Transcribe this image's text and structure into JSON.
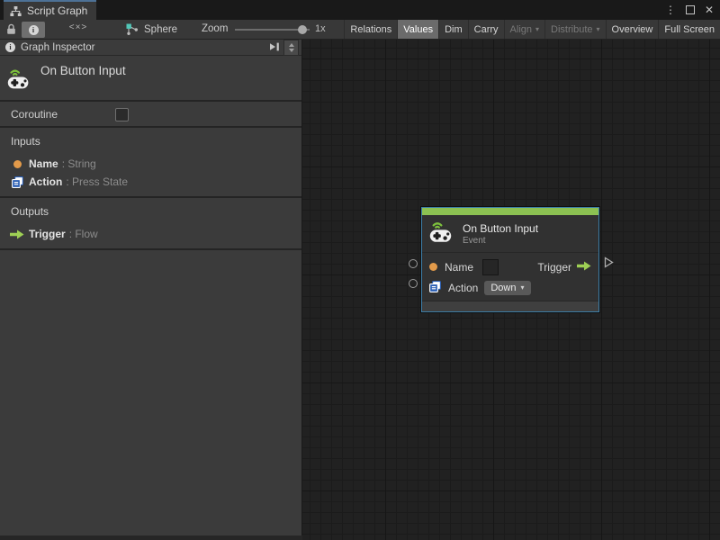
{
  "colors": {
    "accent_green": "#8cc152",
    "selection_blue": "#3d7ea8",
    "string_orange": "#e29a4a",
    "flow_green": "#9ed054",
    "enum_blue": "#2b5fb4",
    "focus_tab_blue": "#4d7196",
    "graph_icon_teal": "#52c7b8"
  },
  "icons": {
    "chevron_down": "▾",
    "kebab_menu": "⋮",
    "close": "✕",
    "code_view": "<×>"
  },
  "tabbar": {
    "tab_label": "Script Graph"
  },
  "toolbar": {
    "graph_name": "Sphere",
    "zoom_label": "Zoom",
    "zoom_value": "1x",
    "buttons": [
      {
        "label": "Relations",
        "state": "normal"
      },
      {
        "label": "Values",
        "state": "selected"
      },
      {
        "label": "Dim",
        "state": "normal"
      },
      {
        "label": "Carry",
        "state": "normal"
      },
      {
        "label": "Align",
        "state": "disabled",
        "dropdown": true
      },
      {
        "label": "Distribute",
        "state": "disabled",
        "dropdown": true
      },
      {
        "label": "Overview",
        "state": "normal"
      },
      {
        "label": "Full Screen",
        "state": "normal"
      }
    ]
  },
  "inspector": {
    "header_title": "Graph Inspector",
    "unit_title": "On Button Input",
    "coroutine": {
      "label": "Coroutine",
      "checked": false
    },
    "inputs": {
      "title": "Inputs",
      "items": [
        {
          "name": "Name",
          "type_text": ": String"
        },
        {
          "name": "Action",
          "type_text": ": Press State"
        }
      ]
    },
    "outputs": {
      "title": "Outputs",
      "items": [
        {
          "name": "Trigger",
          "type_text": ": Flow"
        }
      ]
    }
  },
  "node": {
    "title": "On Button Input",
    "subtitle": "Event",
    "name_port_label": "Name",
    "name_port_value": "",
    "trigger_port_label": "Trigger",
    "action_port_label": "Action",
    "action_value": "Down"
  }
}
